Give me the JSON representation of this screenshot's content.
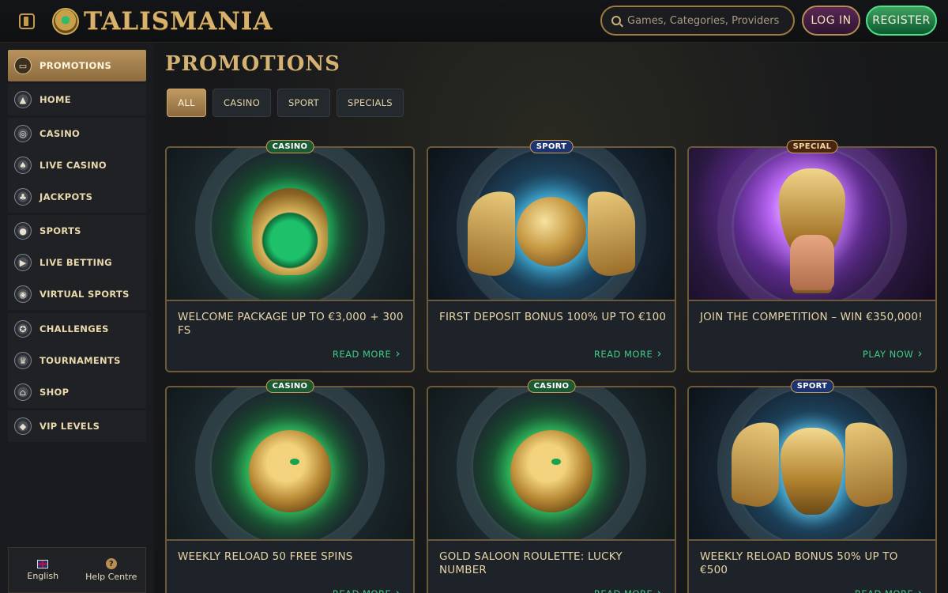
{
  "header": {
    "logo_text": "TALISMANIA",
    "search_placeholder": "Games, Categories, Providers",
    "login_label": "LOG IN",
    "register_label": "REGISTER"
  },
  "sidebar": {
    "items": [
      {
        "label": "PROMOTIONS",
        "icon": "promotions-icon",
        "active": true
      },
      {
        "label": "HOME",
        "icon": "home-icon"
      },
      {
        "label": "CASINO",
        "icon": "casino-icon"
      },
      {
        "label": "LIVE CASINO",
        "icon": "live-casino-icon"
      },
      {
        "label": "JACKPOTS",
        "icon": "jackpots-icon"
      },
      {
        "label": "SPORTS",
        "icon": "sports-icon"
      },
      {
        "label": "LIVE BETTING",
        "icon": "live-betting-icon"
      },
      {
        "label": "VIRTUAL SPORTS",
        "icon": "virtual-sports-icon"
      },
      {
        "label": "CHALLENGES",
        "icon": "challenges-icon"
      },
      {
        "label": "TOURNAMENTS",
        "icon": "tournaments-icon"
      },
      {
        "label": "SHOP",
        "icon": "shop-icon"
      },
      {
        "label": "VIP LEVELS",
        "icon": "vip-levels-icon"
      }
    ],
    "footer": {
      "language_label": "English",
      "help_label": "Help Centre",
      "help_glyph": "?"
    }
  },
  "main": {
    "title": "PROMOTIONS",
    "filters": [
      {
        "label": "ALL",
        "active": true
      },
      {
        "label": "CASINO"
      },
      {
        "label": "SPORT"
      },
      {
        "label": "SPECIALS"
      }
    ],
    "cards": [
      {
        "badge": "CASINO",
        "title": "WELCOME PACKAGE UP TO €3,000 + 300 FS",
        "link": "READ MORE"
      },
      {
        "badge": "SPORT",
        "title": "FIRST DEPOSIT BONUS 100% UP TO €100",
        "link": "READ MORE"
      },
      {
        "badge": "SPECIAL",
        "title": "JOIN THE COMPETITION – WIN €350,000!",
        "link": "PLAY NOW"
      },
      {
        "badge": "CASINO",
        "title": "WEEKLY RELOAD 50 FREE SPINS",
        "link": "READ MORE"
      },
      {
        "badge": "CASINO",
        "title": "GOLD SALOON ROULETTE: LUCKY NUMBER",
        "link": "READ MORE"
      },
      {
        "badge": "SPORT",
        "title": "WEEKLY RELOAD BONUS 50% UP TO €500",
        "link": "READ MORE"
      }
    ]
  },
  "colors": {
    "gold": "#d5b172",
    "active_filter": "#c09a61",
    "link_green": "#43c985",
    "register_green": "#3ea160",
    "login_purple": "#5a2856"
  }
}
